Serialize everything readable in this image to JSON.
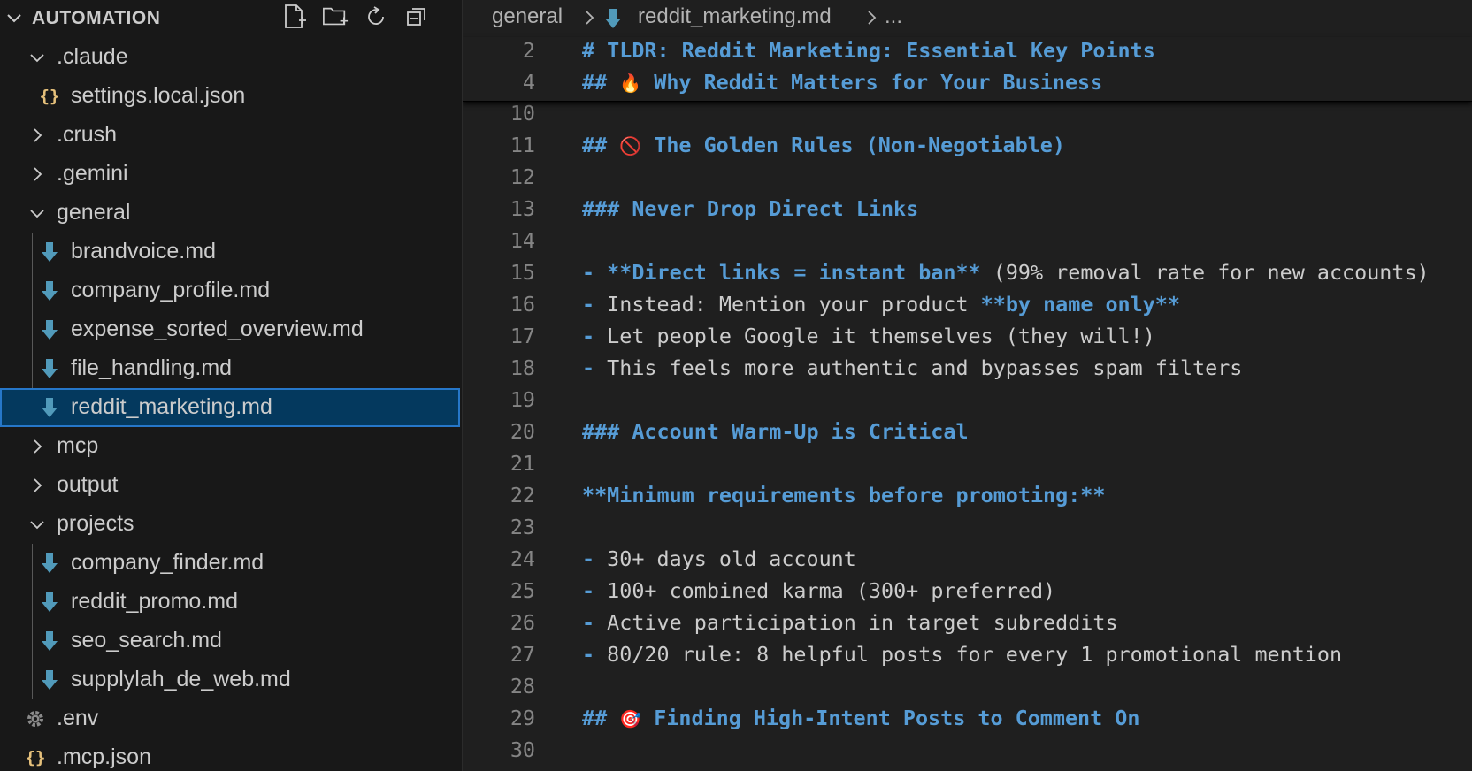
{
  "explorer": {
    "title": "AUTOMATION",
    "actions": [
      {
        "name": "new-file-icon"
      },
      {
        "name": "new-folder-icon"
      },
      {
        "name": "refresh-icon"
      },
      {
        "name": "collapse-all-icon"
      }
    ],
    "items": [
      {
        "label": ".claude",
        "type": "folder",
        "expanded": true,
        "depth": 1
      },
      {
        "label": "settings.local.json",
        "type": "json",
        "depth": 2
      },
      {
        "label": ".crush",
        "type": "folder",
        "expanded": false,
        "depth": 1
      },
      {
        "label": ".gemini",
        "type": "folder",
        "expanded": false,
        "depth": 1
      },
      {
        "label": "general",
        "type": "folder",
        "expanded": true,
        "depth": 1
      },
      {
        "label": "brandvoice.md",
        "type": "md",
        "depth": 2
      },
      {
        "label": "company_profile.md",
        "type": "md",
        "depth": 2
      },
      {
        "label": "expense_sorted_overview.md",
        "type": "md",
        "depth": 2
      },
      {
        "label": "file_handling.md",
        "type": "md",
        "depth": 2
      },
      {
        "label": "reddit_marketing.md",
        "type": "md",
        "depth": 2,
        "selected": true
      },
      {
        "label": "mcp",
        "type": "folder",
        "expanded": false,
        "depth": 1
      },
      {
        "label": "output",
        "type": "folder",
        "expanded": false,
        "depth": 1
      },
      {
        "label": "projects",
        "type": "folder",
        "expanded": true,
        "depth": 1
      },
      {
        "label": "company_finder.md",
        "type": "md",
        "depth": 2
      },
      {
        "label": "reddit_promo.md",
        "type": "md",
        "depth": 2
      },
      {
        "label": "seo_search.md",
        "type": "md",
        "depth": 2
      },
      {
        "label": "supplylah_de_web.md",
        "type": "md",
        "depth": 2
      },
      {
        "label": ".env",
        "type": "gear",
        "depth": 1
      },
      {
        "label": ".mcp.json",
        "type": "json",
        "depth": 1
      }
    ]
  },
  "breadcrumb": {
    "folder": "general",
    "file": "reddit_marketing.md",
    "more": "..."
  },
  "editor": {
    "sticky_lines": [
      {
        "n": "2",
        "parts": [
          {
            "c": "h",
            "t": "# TLDR: Reddit Marketing: Essential Key Points"
          }
        ]
      },
      {
        "n": "4",
        "parts": [
          {
            "c": "h",
            "t": "## "
          },
          {
            "c": "emo",
            "t": "🔥"
          },
          {
            "c": "h",
            "t": " Why Reddit Matters for Your Business"
          }
        ]
      }
    ],
    "lines": [
      {
        "n": "10",
        "parts": []
      },
      {
        "n": "11",
        "parts": [
          {
            "c": "h",
            "t": "## "
          },
          {
            "c": "emo",
            "t": "🚫"
          },
          {
            "c": "h",
            "t": " The Golden Rules (Non-Negotiable)"
          }
        ]
      },
      {
        "n": "12",
        "parts": []
      },
      {
        "n": "13",
        "parts": [
          {
            "c": "h",
            "t": "### Never Drop Direct Links"
          }
        ]
      },
      {
        "n": "14",
        "parts": []
      },
      {
        "n": "15",
        "parts": [
          {
            "c": "h",
            "t": "- "
          },
          {
            "c": "b",
            "t": "**Direct links = instant ban**"
          },
          {
            "c": "t",
            "t": " (99% removal rate for new accounts)"
          }
        ]
      },
      {
        "n": "16",
        "parts": [
          {
            "c": "h",
            "t": "- "
          },
          {
            "c": "t",
            "t": "Instead: Mention your product "
          },
          {
            "c": "b",
            "t": "**by name only**"
          }
        ]
      },
      {
        "n": "17",
        "parts": [
          {
            "c": "h",
            "t": "- "
          },
          {
            "c": "t",
            "t": "Let people Google it themselves (they will!)"
          }
        ]
      },
      {
        "n": "18",
        "parts": [
          {
            "c": "h",
            "t": "- "
          },
          {
            "c": "t",
            "t": "This feels more authentic and bypasses spam filters"
          }
        ]
      },
      {
        "n": "19",
        "parts": []
      },
      {
        "n": "20",
        "parts": [
          {
            "c": "h",
            "t": "### Account Warm-Up is Critical"
          }
        ]
      },
      {
        "n": "21",
        "parts": []
      },
      {
        "n": "22",
        "parts": [
          {
            "c": "b",
            "t": "**Minimum requirements before promoting:**"
          }
        ]
      },
      {
        "n": "23",
        "parts": []
      },
      {
        "n": "24",
        "parts": [
          {
            "c": "h",
            "t": "- "
          },
          {
            "c": "t",
            "t": "30+ days old account"
          }
        ]
      },
      {
        "n": "25",
        "parts": [
          {
            "c": "h",
            "t": "- "
          },
          {
            "c": "t",
            "t": "100+ combined karma (300+ preferred)"
          }
        ]
      },
      {
        "n": "26",
        "parts": [
          {
            "c": "h",
            "t": "- "
          },
          {
            "c": "t",
            "t": "Active participation in target subreddits"
          }
        ]
      },
      {
        "n": "27",
        "parts": [
          {
            "c": "h",
            "t": "- "
          },
          {
            "c": "t",
            "t": "80/20 rule: 8 helpful posts for every 1 promotional mention"
          }
        ]
      },
      {
        "n": "28",
        "parts": []
      },
      {
        "n": "29",
        "parts": [
          {
            "c": "h",
            "t": "## "
          },
          {
            "c": "emo",
            "t": "🎯"
          },
          {
            "c": "h",
            "t": " Finding High-Intent Posts to Comment On"
          }
        ]
      },
      {
        "n": "30",
        "parts": []
      }
    ]
  },
  "colors": {
    "heading": "#569cd6",
    "text": "#cccccc",
    "selected_bg": "#04395e",
    "selected_border": "#2677c9",
    "md_icon": "#519aba",
    "json_icon": "#e5c07b"
  }
}
